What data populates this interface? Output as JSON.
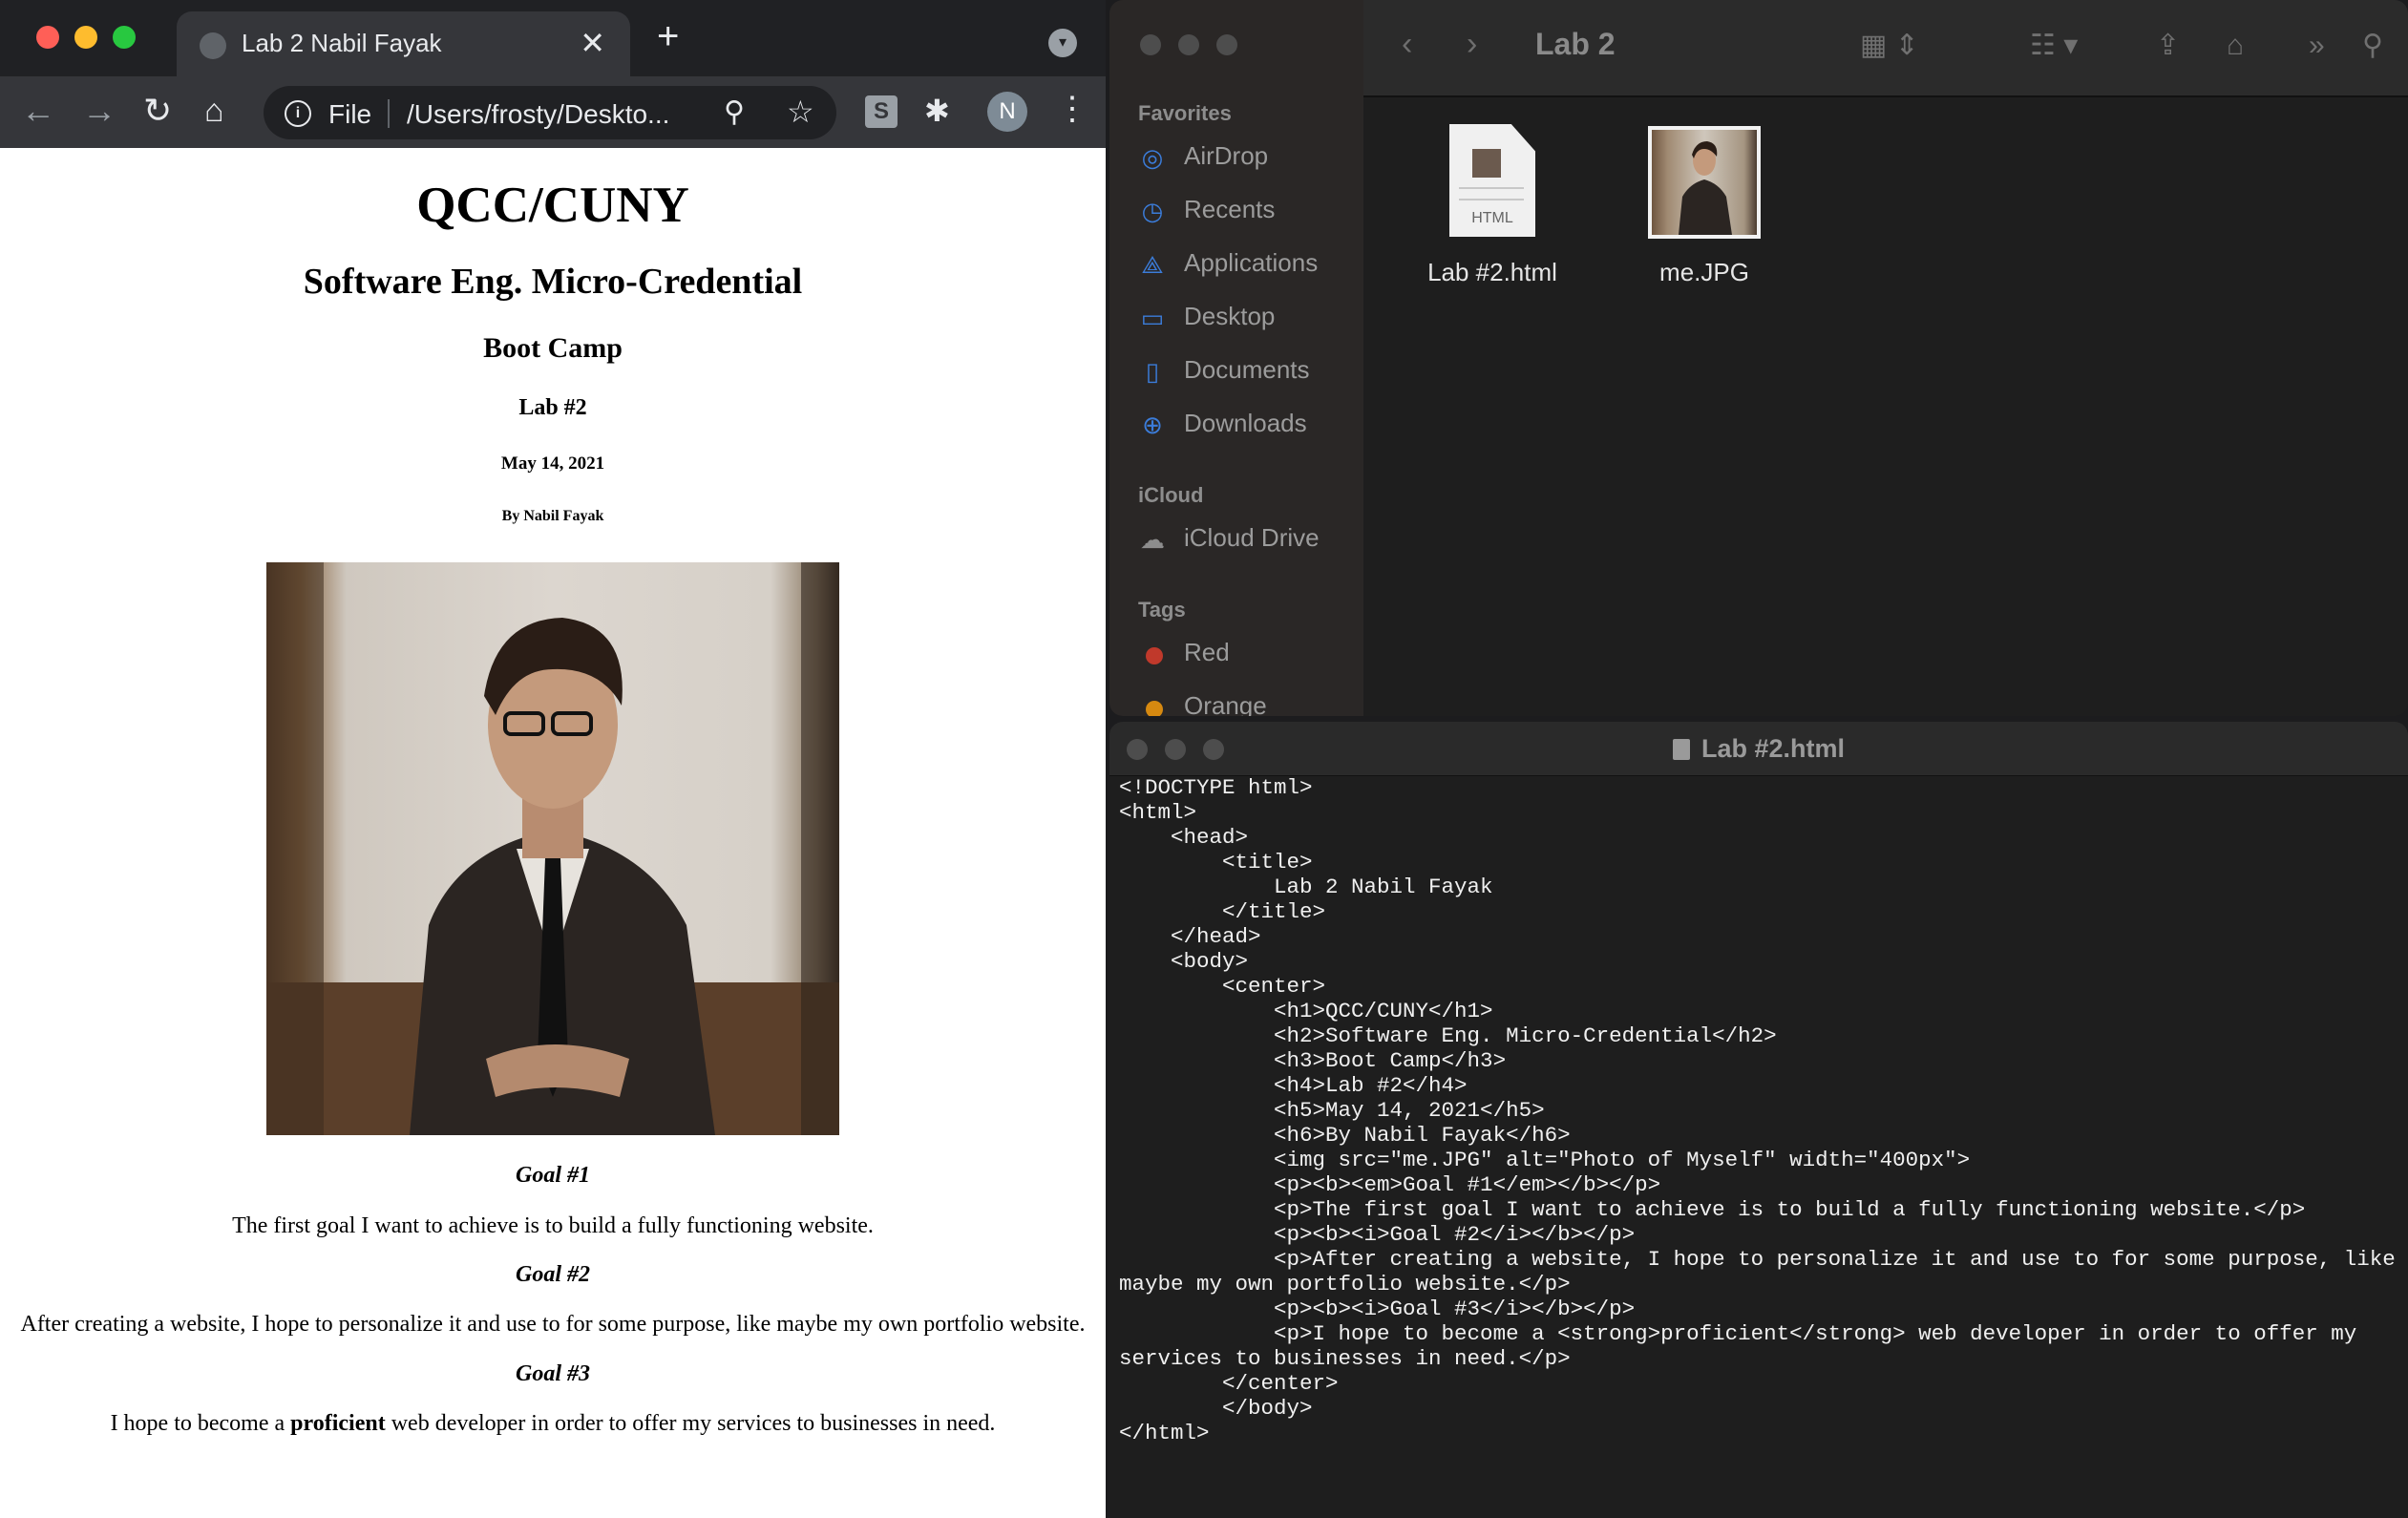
{
  "browser": {
    "tab_title": "Lab 2 Nabil Fayak",
    "tab_close": "✕",
    "new_tab": "+",
    "omnibox": {
      "scheme_label": "File",
      "url": "/Users/frosty/Deskto..."
    },
    "profile_initial": "N",
    "page": {
      "h1": "QCC/CUNY",
      "h2": "Software Eng. Micro-Credential",
      "h3": "Boot Camp",
      "h4": "Lab #2",
      "h5": "May 14, 2021",
      "h6": "By Nabil Fayak",
      "goal1_heading": "Goal #1",
      "goal1_text": "The first goal I want to achieve is to build a fully functioning website.",
      "goal2_heading": "Goal #2",
      "goal2_text": "After creating a website, I hope to personalize it and use to for some purpose, like maybe my own portfolio website.",
      "goal3_heading": "Goal #3",
      "goal3_before": "I hope to become a ",
      "goal3_strong": "proficient",
      "goal3_after": " web developer in order to offer my services to businesses in need."
    }
  },
  "finder": {
    "title": "Lab 2",
    "sections": {
      "favorites": "Favorites",
      "icloud": "iCloud",
      "tags": "Tags"
    },
    "favorites": [
      {
        "label": "AirDrop",
        "icon": "airdrop-icon"
      },
      {
        "label": "Recents",
        "icon": "clock-icon"
      },
      {
        "label": "Applications",
        "icon": "applications-icon"
      },
      {
        "label": "Desktop",
        "icon": "desktop-icon"
      },
      {
        "label": "Documents",
        "icon": "document-icon"
      },
      {
        "label": "Downloads",
        "icon": "download-icon"
      }
    ],
    "icloud_items": [
      {
        "label": "iCloud Drive",
        "icon": "cloud-icon"
      }
    ],
    "tags": [
      {
        "label": "Red",
        "color": "#c0392b"
      },
      {
        "label": "Orange",
        "color": "#d68910"
      }
    ],
    "files": [
      {
        "name": "Lab #2.html",
        "icon": "html-file-icon",
        "ext": "HTML"
      },
      {
        "name": "me.JPG",
        "icon": "image-file-icon"
      }
    ]
  },
  "editor": {
    "title": "Lab #2.html",
    "code": "<!DOCTYPE html>\n<html>\n    <head>\n        <title>\n            Lab 2 Nabil Fayak\n        </title>\n    </head>\n    <body>\n        <center>\n            <h1>QCC/CUNY</h1>\n            <h2>Software Eng. Micro-Credential</h2>\n            <h3>Boot Camp</h3>\n            <h4>Lab #2</h4>\n            <h5>May 14, 2021</h5>\n            <h6>By Nabil Fayak</h6>\n            <img src=\"me.JPG\" alt=\"Photo of Myself\" width=\"400px\">\n            <p><b><em>Goal #1</em></b></p>\n            <p>The first goal I want to achieve is to build a fully functioning website.</p>\n            <p><b><i>Goal #2</i></b></p>\n            <p>After creating a website, I hope to personalize it and use to for some purpose, like\nmaybe my own portfolio website.</p>\n            <p><b><i>Goal #3</i></b></p>\n            <p>I hope to become a <strong>proficient</strong> web developer in order to offer my\nservices to businesses in need.</p>\n        </center>\n        </body>\n</html>"
  }
}
